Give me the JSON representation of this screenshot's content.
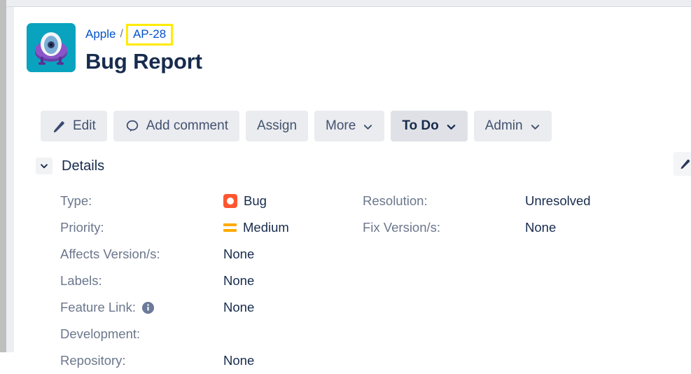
{
  "breadcrumb": {
    "project_link": "Apple",
    "separator": "/",
    "issue_key": "AP-28",
    "highlight_color": "#ffeb00",
    "link_color": "#0052cc"
  },
  "header": {
    "title": "Bug Report",
    "avatar_name": "alien-ufo-avatar",
    "avatar_bg": "#0aa3bf"
  },
  "toolbar": {
    "edit_label": "Edit",
    "add_comment_label": "Add comment",
    "assign_label": "Assign",
    "more_label": "More",
    "status_label": "To Do",
    "admin_label": "Admin"
  },
  "details": {
    "section_title": "Details",
    "left_column": [
      {
        "label": "Type:",
        "value": "Bug",
        "icon": "bug-icon"
      },
      {
        "label": "Priority:",
        "value": "Medium",
        "icon": "priority-medium-icon"
      },
      {
        "label": "Affects Version/s:",
        "value": "None",
        "icon": null
      },
      {
        "label": "Labels:",
        "value": "None",
        "icon": null
      },
      {
        "label": "Feature Link:",
        "value": "None",
        "icon": null,
        "label_icon": "info-icon"
      },
      {
        "label": "Development:",
        "value": "",
        "icon": null
      },
      {
        "label": "Repository:",
        "value": "None",
        "icon": null
      }
    ],
    "right_column": [
      {
        "label": "Resolution:",
        "value": "Unresolved"
      },
      {
        "label": "Fix Version/s:",
        "value": "None"
      }
    ]
  },
  "colors": {
    "bug_red": "#ff5630",
    "priority_orange": "#ffab00",
    "text_primary": "#172b4d",
    "text_subtle": "#6b778c",
    "button_bg": "#ebecf0",
    "status_bg": "#dfe1e6"
  },
  "edge_button": {
    "name": "edit-field-pencil"
  }
}
